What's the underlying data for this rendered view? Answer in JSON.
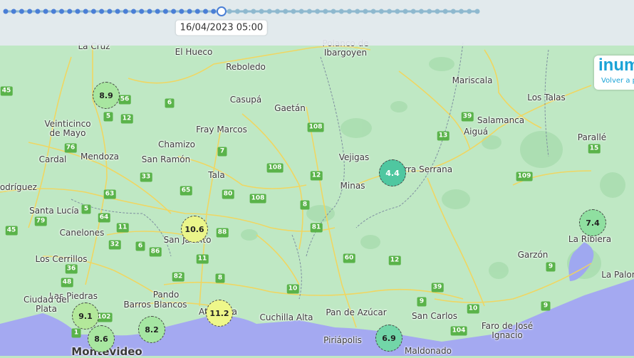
{
  "timeline": {
    "selected_label": "16/04/2023 05:00",
    "selected_fraction": 0.45,
    "colors": {
      "active": "#4a7fd6",
      "inactive": "#8fb9cf"
    }
  },
  "brand": {
    "logo_text": "inum",
    "link_text": "Volver a p"
  },
  "places": [
    {
      "name": "La Cruz"
    },
    {
      "name": "El Hueco"
    },
    {
      "name": "Polanco de Ibargoyen"
    },
    {
      "name": "Reboledo"
    },
    {
      "name": "Mariscala"
    },
    {
      "name": "Casupá"
    },
    {
      "name": "Gaetán"
    },
    {
      "name": "Los Talas"
    },
    {
      "name": "Salamanca"
    },
    {
      "name": "Veinticinco de Mayo"
    },
    {
      "name": "Fray Marcos"
    },
    {
      "name": "Aiguá"
    },
    {
      "name": "Parallé"
    },
    {
      "name": "Chamizo"
    },
    {
      "name": "Mendoza"
    },
    {
      "name": "Cardal"
    },
    {
      "name": "San Ramón"
    },
    {
      "name": "Vejigas"
    },
    {
      "name": "Tala"
    },
    {
      "name": "Minas"
    },
    {
      "name": "Sierra Serrana"
    },
    {
      "name": "Rodríguez"
    },
    {
      "name": "Santa Lucía"
    },
    {
      "name": "Canelones"
    },
    {
      "name": "San Jacinto"
    },
    {
      "name": "Los Cerrillos"
    },
    {
      "name": "Garzón"
    },
    {
      "name": "La Ribiera"
    },
    {
      "name": "Las Piedras"
    },
    {
      "name": "Ciudad del Plata"
    },
    {
      "name": "Pando"
    },
    {
      "name": "Barros Blancos"
    },
    {
      "name": "Atlántida"
    },
    {
      "name": "Cuchilla Alta"
    },
    {
      "name": "Pan de Azúcar"
    },
    {
      "name": "San Carlos"
    },
    {
      "name": "Faro de José Ignacio"
    },
    {
      "name": "Piriápolis"
    },
    {
      "name": "Maldonado"
    },
    {
      "name": "Montevideo"
    },
    {
      "name": "La Paloma"
    }
  ],
  "route_numbers": [
    "45",
    "56",
    "6",
    "5",
    "12",
    "76",
    "108",
    "7",
    "39",
    "13",
    "15",
    "33",
    "108",
    "12",
    "63",
    "65",
    "80",
    "109",
    "5",
    "64",
    "108",
    "8",
    "79",
    "11",
    "81",
    "45",
    "32",
    "6",
    "86",
    "88",
    "60",
    "12",
    "36",
    "82",
    "9",
    "48",
    "11",
    "8",
    "10",
    "102",
    "1",
    "39",
    "9",
    "10",
    "104",
    "9"
  ],
  "clusters": [
    {
      "value": "8.9",
      "color": "#a8e6a0"
    },
    {
      "value": "4.4",
      "color": "#4fc7a0"
    },
    {
      "value": "10.6",
      "color": "#eaf58a"
    },
    {
      "value": "7.4",
      "color": "#8fdfa0"
    },
    {
      "value": "9.1",
      "color": "#b3e89a"
    },
    {
      "value": "8.6",
      "color": "#a8e6a0"
    },
    {
      "value": "8.2",
      "color": "#a5e6a2"
    },
    {
      "value": "11.2",
      "color": "#eef78a"
    },
    {
      "value": "6.9",
      "color": "#72d6a8"
    }
  ]
}
